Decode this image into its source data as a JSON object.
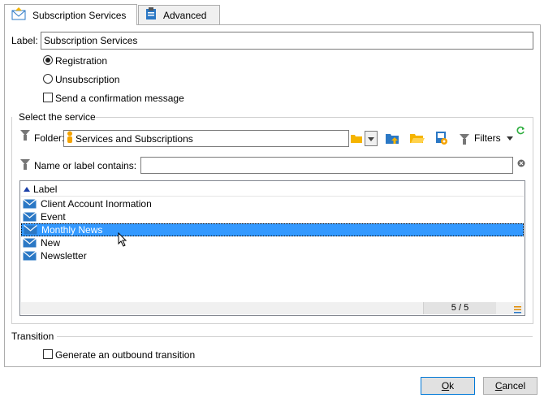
{
  "tabs": [
    {
      "label": "Subscription Services",
      "icon": "envelope-icon"
    },
    {
      "label": "Advanced",
      "icon": "clipboard-icon"
    }
  ],
  "form": {
    "label_caption": "Label:",
    "label_value": "Subscription Services",
    "radio_registration": "Registration",
    "radio_unsubscription": "Unsubscription",
    "send_confirmation": "Send a confirmation message"
  },
  "service": {
    "section_title": "Select the service",
    "folder_caption": "Folder:",
    "folder_value": "Services and Subscriptions",
    "filters_label": "Filters",
    "name_filter_caption": "Name or label contains:",
    "name_filter_value": "",
    "column_header": "Label",
    "items": [
      "Client Account Inormation",
      "Event",
      "Monthly News",
      "New",
      "Newsletter"
    ],
    "selected_index": 2,
    "count": "5 / 5"
  },
  "transition": {
    "section_title": "Transition",
    "generate_outbound": "Generate an outbound transition"
  },
  "buttons": {
    "ok_first": "O",
    "ok_rest": "k",
    "cancel_first": "C",
    "cancel_rest": "ancel"
  },
  "colors": {
    "selection": "#3399ff",
    "envelope": "#2b78c5",
    "folder": "#f5b400",
    "refresh": "#2eae3f"
  }
}
